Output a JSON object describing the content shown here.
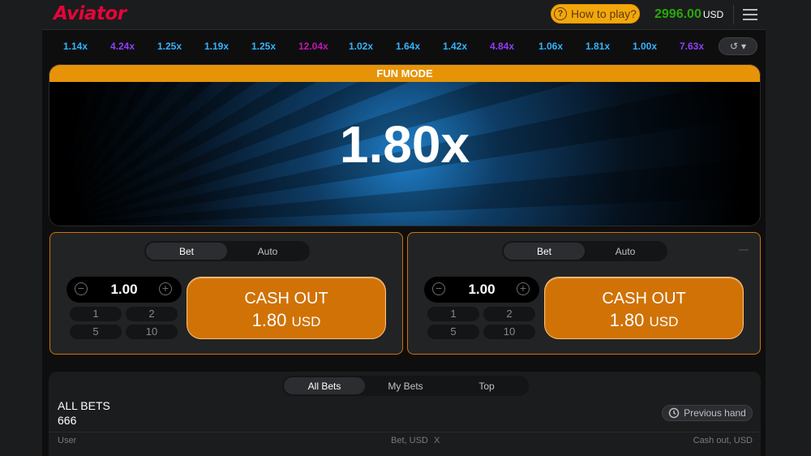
{
  "header": {
    "logo": "Aviator",
    "how_to_play": "How to play?",
    "balance": "2996.00",
    "currency": "USD"
  },
  "history": {
    "multipliers": [
      {
        "value": "1.14x",
        "color": "#34b4ff"
      },
      {
        "value": "4.24x",
        "color": "#913ef8"
      },
      {
        "value": "1.25x",
        "color": "#34b4ff"
      },
      {
        "value": "1.19x",
        "color": "#34b4ff"
      },
      {
        "value": "1.25x",
        "color": "#34b4ff"
      },
      {
        "value": "12.04x",
        "color": "#c017b4"
      },
      {
        "value": "1.02x",
        "color": "#34b4ff"
      },
      {
        "value": "1.64x",
        "color": "#34b4ff"
      },
      {
        "value": "1.42x",
        "color": "#34b4ff"
      },
      {
        "value": "4.84x",
        "color": "#913ef8"
      },
      {
        "value": "1.06x",
        "color": "#34b4ff"
      },
      {
        "value": "1.81x",
        "color": "#34b4ff"
      },
      {
        "value": "1.00x",
        "color": "#34b4ff"
      },
      {
        "value": "7.63x",
        "color": "#913ef8"
      }
    ]
  },
  "game": {
    "mode_label": "FUN MODE",
    "multiplier": "1.80x"
  },
  "panels": [
    {
      "tab_bet": "Bet",
      "tab_auto": "Auto",
      "amount": "1.00",
      "quick": [
        "1",
        "2",
        "5",
        "10"
      ],
      "cash_title": "CASH OUT",
      "cash_amount": "1.80",
      "cash_currency": "USD"
    },
    {
      "tab_bet": "Bet",
      "tab_auto": "Auto",
      "amount": "1.00",
      "quick": [
        "1",
        "2",
        "5",
        "10"
      ],
      "cash_title": "CASH OUT",
      "cash_amount": "1.80",
      "cash_currency": "USD"
    }
  ],
  "bets": {
    "tabs": [
      "All Bets",
      "My Bets",
      "Top"
    ],
    "title": "ALL BETS",
    "count": "666",
    "previous_hand": "Previous hand",
    "columns": [
      "User",
      "Bet, USD",
      "X",
      "Cash out, USD"
    ]
  }
}
